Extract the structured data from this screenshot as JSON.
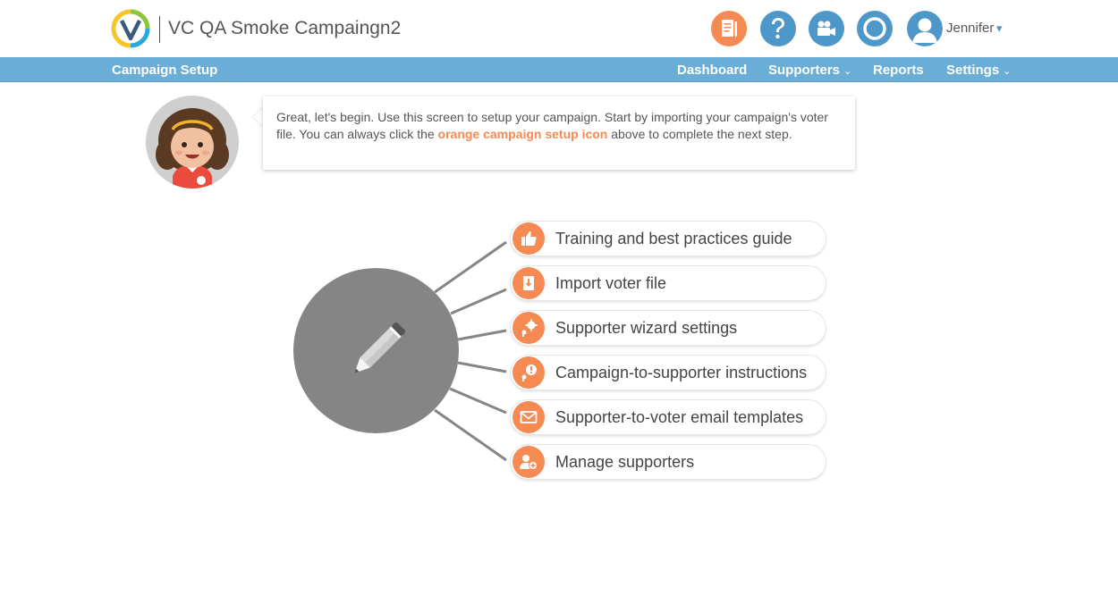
{
  "header": {
    "app_title": "VC QA Smoke Campaingn2",
    "user_name": "Jennifer",
    "user_caret": "▾",
    "icons": [
      "campaign-setup-icon",
      "help-icon",
      "video-icon",
      "circle-icon",
      "user-avatar"
    ],
    "colors": {
      "orange": "#f58a52",
      "blue": "#4d97c9",
      "nav": "#6aaed7"
    }
  },
  "nav": {
    "title": "Campaign Setup",
    "dashboard": "Dashboard",
    "supporters": "Supporters",
    "reports": "Reports",
    "settings": "Settings",
    "chevron": "⌄"
  },
  "guide": {
    "text_before": "Great, let's begin. Use this screen to setup your campaign. Start by importing your campaign's voter file. You can always click the ",
    "highlight": "orange campaign setup icon",
    "text_after": " above to complete the next step."
  },
  "steps": [
    {
      "label": "Training and best practices guide",
      "icon": "thumbs-up-icon"
    },
    {
      "label": "Import voter file",
      "icon": "import-file-icon"
    },
    {
      "label": "Supporter wizard settings",
      "icon": "gear-wand-icon"
    },
    {
      "label": "Campaign-to-supporter instructions",
      "icon": "info-wand-icon"
    },
    {
      "label": "Supporter-to-voter email templates",
      "icon": "envelope-icon"
    },
    {
      "label": "Manage supporters",
      "icon": "add-user-icon"
    }
  ]
}
